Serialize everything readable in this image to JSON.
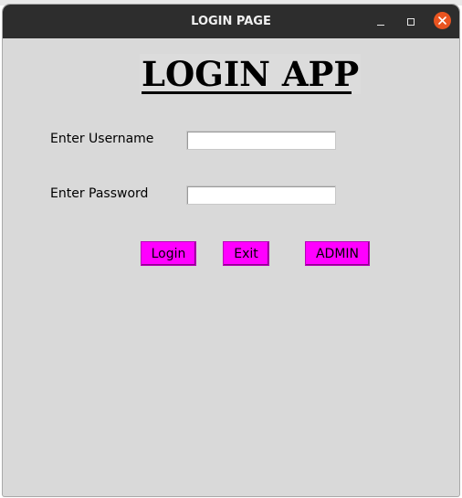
{
  "window": {
    "title": "LOGIN PAGE"
  },
  "app": {
    "heading": "LOGIN APP",
    "username_label": "Enter Username",
    "password_label": "Enter Password",
    "username_value": "",
    "password_value": "",
    "buttons": {
      "login": "Login",
      "exit": "Exit",
      "admin": "ADMIN"
    }
  },
  "colors": {
    "titlebar": "#2d2d2d",
    "window_bg": "#d9d9d9",
    "button_bg": "#ff00ff",
    "close_button": "#e95420"
  },
  "icons": {
    "minimize": "minimize-icon",
    "maximize": "maximize-icon",
    "close": "close-icon"
  }
}
